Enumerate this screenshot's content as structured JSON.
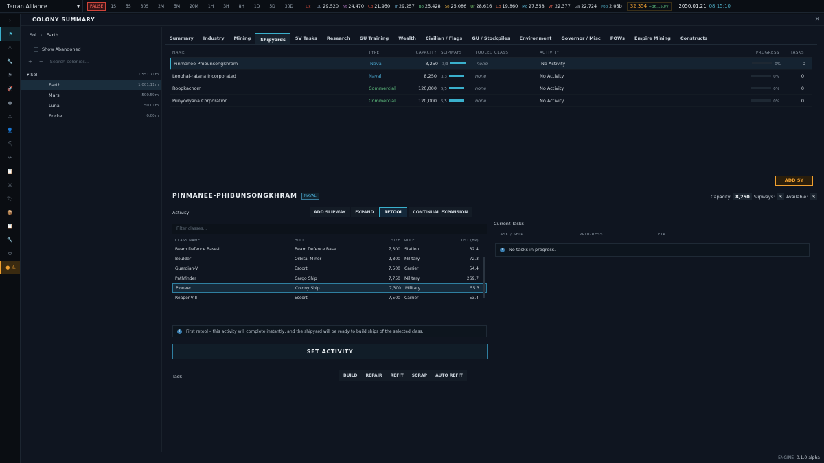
{
  "topbar": {
    "empire": "Terran Alliance",
    "pause": "PAUSE",
    "time_buttons": [
      "1S",
      "5S",
      "30S",
      "2M",
      "5M",
      "20M",
      "1H",
      "3H",
      "8H",
      "1D",
      "5D",
      "30D"
    ],
    "resources": [
      {
        "sym": "Dx",
        "val": "",
        "color": "#e05040"
      },
      {
        "sym": "Du",
        "val": "29,520",
        "color": "#9ab0c8"
      },
      {
        "sym": "Nt",
        "val": "24,470",
        "color": "#c080d0"
      },
      {
        "sym": "Cb",
        "val": "21,950",
        "color": "#e05040"
      },
      {
        "sym": "Tr",
        "val": "29,257",
        "color": "#70b0d0"
      },
      {
        "sym": "Bo",
        "val": "25,428",
        "color": "#5fbf7f"
      },
      {
        "sym": "So",
        "val": "25,086",
        "color": "#d0a040"
      },
      {
        "sym": "Ur",
        "val": "28,616",
        "color": "#7fcf6f"
      },
      {
        "sym": "Co",
        "val": "19,860",
        "color": "#e07050"
      },
      {
        "sym": "Mc",
        "val": "27,558",
        "color": "#60c0e0"
      },
      {
        "sym": "Vn",
        "val": "22,377",
        "color": "#e06050"
      },
      {
        "sym": "Ga",
        "val": "22,724",
        "color": "#a0a8b0"
      },
      {
        "sym": "Pop",
        "val": "2.05b",
        "color": "#4fb0c8"
      }
    ],
    "income": "32,354",
    "income_rate": "+36,150/y",
    "date": "2050.01.21",
    "clock": "08:15:10"
  },
  "rail": {
    "icons": [
      "›",
      "⚑",
      "⚓",
      "🔧",
      "⚑",
      "🚀",
      "●",
      "⚔",
      "👤",
      "⛏",
      "✈",
      "📋",
      "⚔",
      "🏷",
      "📦",
      "📋",
      "🔧",
      "⚙",
      "● ⚠"
    ]
  },
  "window": {
    "title": "COLONY SUMMARY",
    "close": "×"
  },
  "left": {
    "crumb_system": "Sol",
    "crumb_sep": "›",
    "crumb_body": "Earth",
    "show_abandoned": "Show Abandoned",
    "plus": "+",
    "minus": "−",
    "search_placeholder": "Search colonies...",
    "tree": [
      {
        "label": "Sol",
        "value": "1,551.71m",
        "level": 0,
        "caret": "▾"
      },
      {
        "label": "Earth",
        "value": "1,001.11m",
        "level": 1
      },
      {
        "label": "Mars",
        "value": "500.59m",
        "level": 1
      },
      {
        "label": "Luna",
        "value": "50.01m",
        "level": 1
      },
      {
        "label": "Encke",
        "value": "0.00m",
        "level": 1
      }
    ]
  },
  "tabs": [
    "Summary",
    "Industry",
    "Mining",
    "Shipyards",
    "SV Tasks",
    "Research",
    "GU Training",
    "Wealth",
    "Civilian / Flags",
    "GU / Stockpiles",
    "Environment",
    "Governor / Misc",
    "POWs",
    "Empire Mining",
    "Constructs"
  ],
  "shipyards": {
    "headers": [
      "NAME",
      "TYPE",
      "CAPACITY",
      "SLIPWAYS",
      "TOOLED CLASS",
      "ACTIVITY",
      "PROGRESS",
      "TASKS"
    ],
    "rows": [
      {
        "name": "Pinmanee-Phibunsongkhram",
        "type": "Naval",
        "capacity": "8,250",
        "slipways": "3/3",
        "tooled": "none",
        "activity": "No Activity",
        "progress": "0%",
        "tasks": "0"
      },
      {
        "name": "Leophai-ratana Incorporated",
        "type": "Naval",
        "capacity": "8,250",
        "slipways": "3/3",
        "tooled": "none",
        "activity": "No Activity",
        "progress": "0%",
        "tasks": "0"
      },
      {
        "name": "Roopkachorn",
        "type": "Commercial",
        "capacity": "120,000",
        "slipways": "5/5",
        "tooled": "none",
        "activity": "No Activity",
        "progress": "0%",
        "tasks": "0"
      },
      {
        "name": "Punyodyana Corporation",
        "type": "Commercial",
        "capacity": "120,000",
        "slipways": "5/5",
        "tooled": "none",
        "activity": "No Activity",
        "progress": "0%",
        "tasks": "0"
      }
    ]
  },
  "add_sy": "ADD SY",
  "detail": {
    "name": "PINMANEE-PHIBUNSONGKHRAM",
    "badge": "NAVAL",
    "capacity_label": "Capacity:",
    "capacity": "8,250",
    "slipways_label": "Slipways:",
    "slipways": "3",
    "available_label": "Available:",
    "available": "3",
    "activity_label": "Activity",
    "activity_buttons": [
      "ADD SLIPWAY",
      "EXPAND",
      "RETOOL",
      "CONTINUAL EXPANSION"
    ],
    "filter_placeholder": "Filter classes...",
    "class_headers": [
      "CLASS NAME",
      "HULL",
      "SIZE",
      "ROLE",
      "COST (BP)"
    ],
    "classes": [
      {
        "name": "Beam Defence Base-I",
        "hull": "Beam Defence Base",
        "size": "7,500",
        "role": "Station",
        "cost": "32.4"
      },
      {
        "name": "Boulder",
        "hull": "Orbital Miner",
        "size": "2,800",
        "role": "Military",
        "cost": "72.3"
      },
      {
        "name": "Guardian-V",
        "hull": "Escort",
        "size": "7,500",
        "role": "Carrier",
        "cost": "54.4"
      },
      {
        "name": "Pathfinder",
        "hull": "Cargo Ship",
        "size": "7,750",
        "role": "Military",
        "cost": "269.7"
      },
      {
        "name": "Pioneer",
        "hull": "Colony Ship",
        "size": "7,300",
        "role": "Military",
        "cost": "55.3"
      },
      {
        "name": "Reaper-VIII",
        "hull": "Escort",
        "size": "7,500",
        "role": "Carrier",
        "cost": "53.4"
      }
    ],
    "info": "First retool – this activity will complete instantly, and the shipyard will be ready to build ships of the selected class.",
    "set_activity": "SET ACTIVITY",
    "task_label": "Task",
    "task_buttons": [
      "BUILD",
      "REPAIR",
      "REFIT",
      "SCRAP",
      "AUTO REFIT"
    ]
  },
  "current": {
    "title": "Current Tasks",
    "headers": [
      "TASK / SHIP",
      "PROGRESS",
      "ETA"
    ],
    "empty": "No tasks in progress."
  },
  "footer": {
    "engine": "ENGINE",
    "version": "0.1.0-alpha"
  }
}
